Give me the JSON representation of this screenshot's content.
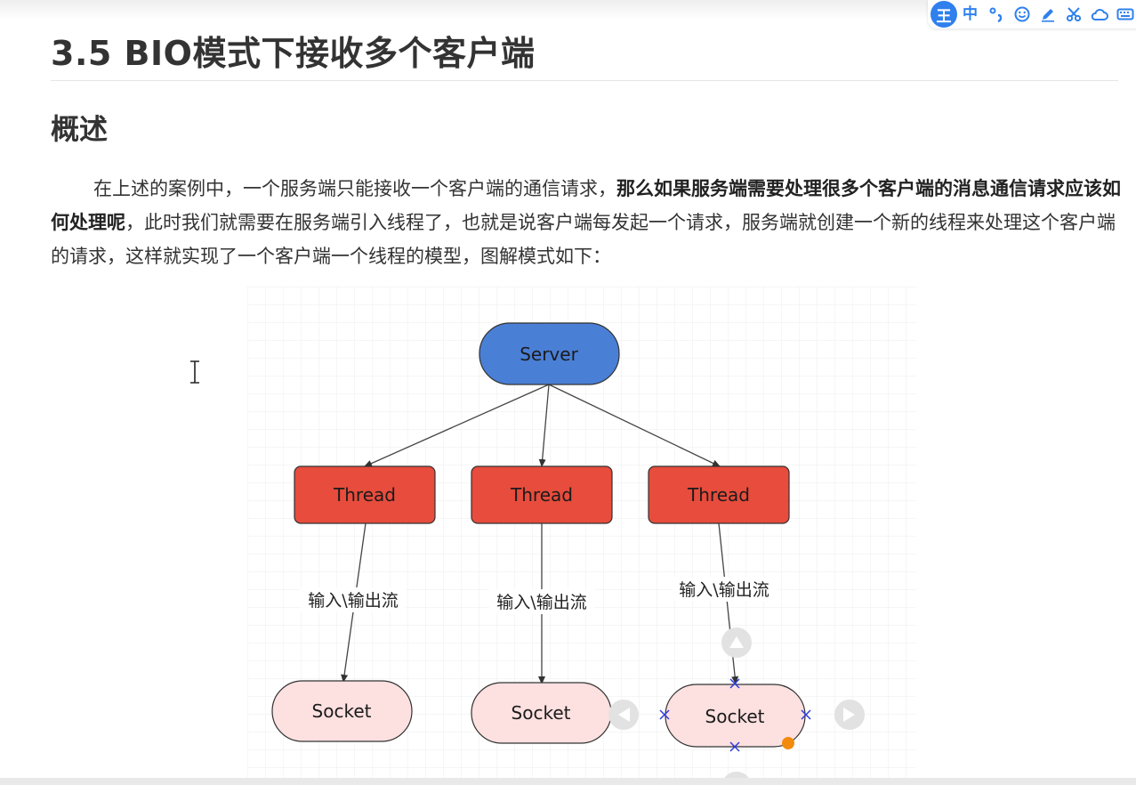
{
  "ime_toolbar": {
    "logo": "王",
    "items": [
      {
        "label": "中",
        "icon": "chinese-mode-icon"
      },
      {
        "label": "",
        "icon": "punctuation-icon"
      },
      {
        "label": "",
        "icon": "emoji-icon"
      },
      {
        "label": "",
        "icon": "pen-icon"
      },
      {
        "label": "",
        "icon": "scissors-icon"
      },
      {
        "label": "",
        "icon": "cloud-icon"
      },
      {
        "label": "",
        "icon": "keyboard-icon"
      }
    ],
    "color": "#2f80ed"
  },
  "heading": "3.5 BIO模式下接收多个客户端",
  "subheading": "概述",
  "paragraph": {
    "part1": "在上述的案例中，一个服务端只能接收一个客户端的通信请求，",
    "bold": "那么如果服务端需要处理很多个客户端的消息通信请求应该如何处理呢",
    "part2": "，此时我们就需要在服务端引入线程了，也就是说客户端每发起一个请求，服务端就创建一个新的线程来处理这个客户端的请求，这样就实现了一个客户端一个线程的模型，图解模式如下："
  },
  "diagram": {
    "server": {
      "label": "Server",
      "color": "#4a7fd6"
    },
    "threads": [
      {
        "label": "Thread",
        "color": "#e74c3c"
      },
      {
        "label": "Thread",
        "color": "#e74c3c"
      },
      {
        "label": "Thread",
        "color": "#e74c3c"
      }
    ],
    "edge_labels": [
      "输入\\输出流",
      "输入\\输出流",
      "输入\\输出流"
    ],
    "sockets": [
      {
        "label": "Socket",
        "color": "#fde0e0"
      },
      {
        "label": "Socket",
        "color": "#fde0e0"
      },
      {
        "label": "Socket",
        "color": "#fde0e0"
      }
    ]
  }
}
